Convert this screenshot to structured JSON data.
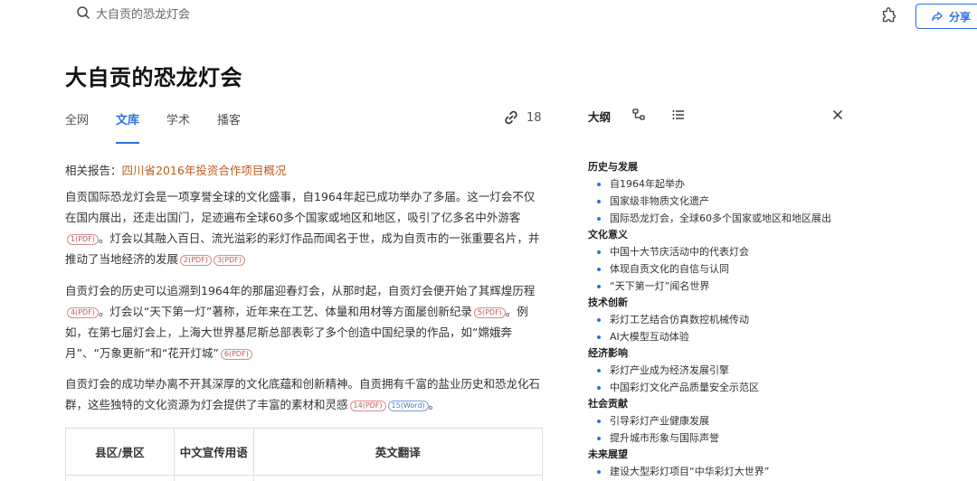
{
  "search": {
    "value": "大自贡的恐龙灯会"
  },
  "header": {
    "share_label": "分享"
  },
  "page": {
    "title": "大自贡的恐龙灯会"
  },
  "tabs": [
    {
      "label": "全网"
    },
    {
      "label": "文库"
    },
    {
      "label": "学术"
    },
    {
      "label": "播客"
    }
  ],
  "link_count": "18",
  "related": {
    "prefix": "相关报告：",
    "link": "四川省2016年投资合作项目概况"
  },
  "paragraphs": {
    "p1_a": "自贡国际恐龙灯会是一项享誉全球的文化盛事，自1964年起已成功举办了多届。这一灯会不仅在国内展出，还走出国门，足迹遍布全球60多个国家或地区和地区，吸引了亿多名中外游客",
    "p1_b": "。灯会以其融入百日、流光溢彩的彩灯作品而闻名于世，成为自贡市的一张重要名片，并推动了当地经济的发展",
    "p2_a": "自贡灯会的历史可以追溯到1964年的那届迎春灯会，从那时起，自贡灯会便开始了其辉煌历程",
    "p2_b": "。灯会以“天下第一灯”著称，近年来在工艺、体量和用材等方面屡创新纪录",
    "p2_c": "。例如，在第七届灯会上，上海大世界基尼斯总部表彰了多个创造中国纪录的作品，如“嫦娥奔月”、“万象更新”和“花开灯城”",
    "p3_a": "自贡灯会的成功举办离不开其深厚的文化底蕴和创新精神。自贡拥有千富的盐业历史和恐龙化石群，这些独特的文化资源为灯会提供了丰富的素材和灵感",
    "p3_b": "。"
  },
  "cites": {
    "c1": "1(PDF)",
    "c2": "2(PDF)",
    "c3": "3(PDF)",
    "c4": "4(PDF)",
    "c5": "5(PDF)",
    "c6": "6(PDF)",
    "c7": "14(PDF)",
    "c8": "15(Word)"
  },
  "table": {
    "headers": [
      "县区/景区",
      "中文宣传用语",
      "英文翻译"
    ]
  },
  "outline": {
    "title": "大纲",
    "sections": [
      {
        "title": "历史与发展",
        "items": [
          "自1964年起举办",
          "国家级非物质文化遗产",
          "国际恐龙灯会，全球60多个国家或地区和地区展出"
        ]
      },
      {
        "title": "文化意义",
        "items": [
          "中国十大节庆活动中的代表灯会",
          "体现自贡文化的自信与认同",
          "“天下第一灯”闻名世界"
        ]
      },
      {
        "title": "技术创新",
        "items": [
          "彩灯工艺结合仿真数控机械传动",
          "AI大模型互动体验"
        ]
      },
      {
        "title": "经济影响",
        "items": [
          "彩灯产业成为经济发展引擎",
          "中国彩灯文化产品质量安全示范区"
        ]
      },
      {
        "title": "社会贡献",
        "items": [
          "引导彩灯产业健康发展",
          "提升城市形象与国际声誉"
        ]
      },
      {
        "title": "未来展望",
        "items": [
          "建设大型彩灯项目“中华彩灯大世界”"
        ]
      }
    ]
  },
  "colors": {
    "accent": "#2d6fe6",
    "link": "#c25a1a"
  }
}
